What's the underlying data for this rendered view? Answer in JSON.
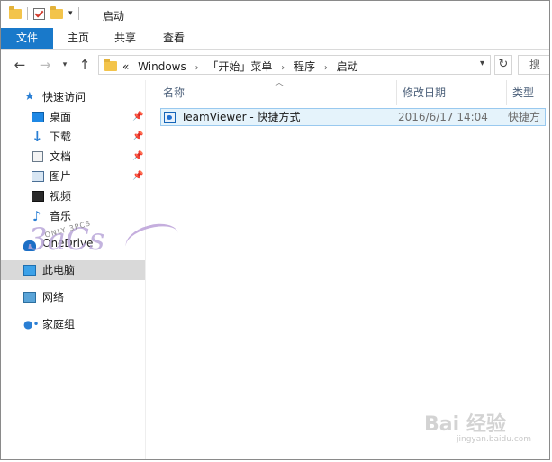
{
  "window": {
    "title": "启动"
  },
  "ribbon": {
    "tabs": [
      "文件",
      "主页",
      "共享",
      "查看"
    ]
  },
  "address": {
    "prefix": "«",
    "crumbs": [
      "Windows",
      "「开始」菜单",
      "程序",
      "启动"
    ],
    "search_placeholder": "搜"
  },
  "nav": {
    "quick_access": "快速访问",
    "items": [
      "桌面",
      "下载",
      "文档",
      "图片",
      "视频",
      "音乐"
    ],
    "onedrive": "OneDrive",
    "this_pc": "此电脑",
    "network": "网络",
    "homegroup": "家庭组"
  },
  "columns": {
    "name": "名称",
    "date": "修改日期",
    "type": "类型"
  },
  "files": [
    {
      "name": "TeamViewer - 快捷方式",
      "date": "2016/6/17 14:04",
      "type": "快捷方"
    }
  ],
  "watermark": {
    "main": "3aCs",
    "sub": "ONLY 3PCS"
  },
  "baidu_watermark": {
    "main": "Bai 经验",
    "sub": "jingyan.baidu.com"
  }
}
